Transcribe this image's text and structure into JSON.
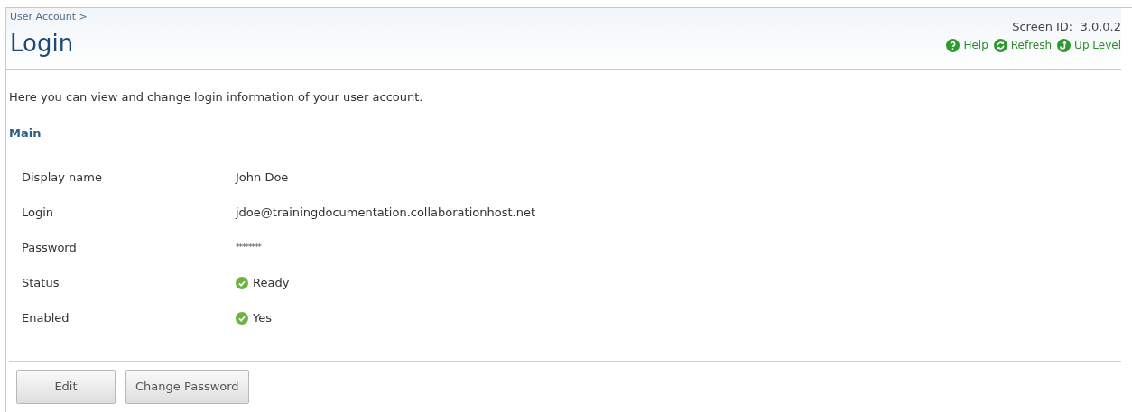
{
  "breadcrumb": [
    "User Account >"
  ],
  "title": "Login",
  "screen_id": "Screen ID:  3.0.0.2",
  "header_links": [
    {
      "label": "Help",
      "kind": "help"
    },
    {
      "label": "Refresh",
      "kind": "refresh"
    },
    {
      "label": "Up Level",
      "kind": "up"
    }
  ],
  "description": "Here you can view and change login information of your user account.",
  "section": {
    "title": "Main",
    "fields": [
      {
        "label": "Display name",
        "value": "John Doe",
        "kind": "text"
      },
      {
        "label": "Login",
        "value": "jdoe@trainingdocumentation.collaborationhost.net",
        "kind": "text"
      },
      {
        "label": "Password",
        "value": "********",
        "kind": "masked"
      },
      {
        "label": "Status",
        "value": "Ready",
        "kind": "status"
      },
      {
        "label": "Enabled",
        "value": "Yes",
        "kind": "status"
      }
    ]
  },
  "buttons": [
    "Edit",
    "Change Password"
  ]
}
